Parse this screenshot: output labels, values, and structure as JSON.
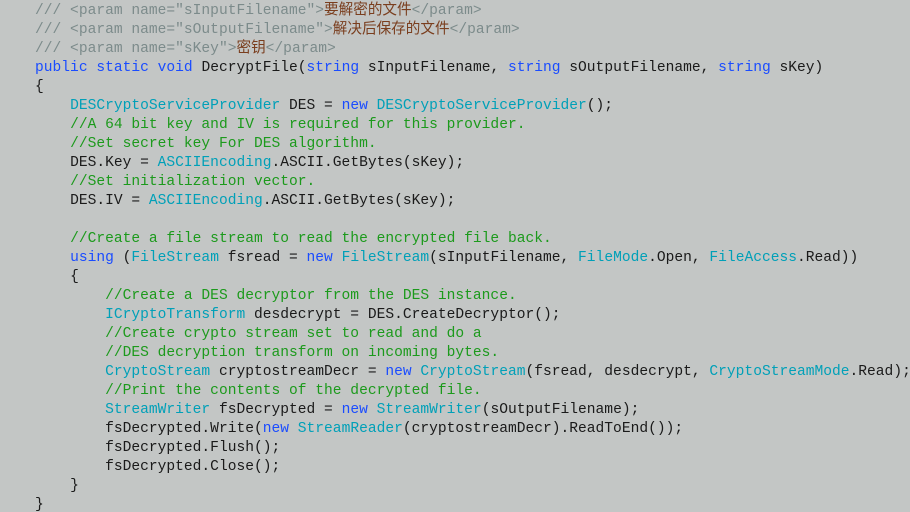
{
  "code": {
    "xml1_pre": "/// <param name=\"sInputFilename\">",
    "xml1_cjk": "要解密的文件",
    "xml1_post": "</param>",
    "xml2_pre": "/// <param name=\"sOutputFilename\">",
    "xml2_cjk": "解决后保存的文件",
    "xml2_post": "</param>",
    "xml3_pre": "/// <param name=\"sKey\">",
    "xml3_cjk": "密钥",
    "xml3_post": "</param>",
    "kw_public": "public",
    "kw_static": "static",
    "kw_void": "void",
    "kw_string": "string",
    "kw_new": "new",
    "kw_using": "using",
    "fn_name": " DecryptFile(",
    "p1": " sInputFilename, ",
    "p2": " sOutputFilename, ",
    "p3": " sKey)",
    "brace_o": "{",
    "brace_c": "}",
    "t_des": "DESCryptoServiceProvider",
    "l_des_decl": " DES = ",
    "l_des_decl2": "();",
    "c_64": "//A 64 bit key and IV is required for this provider.",
    "c_setkey": "//Set secret key For DES algorithm.",
    "l_key1": "DES.Key = ",
    "t_ascii": "ASCIIEncoding",
    "l_key2": ".ASCII.GetBytes(sKey);",
    "c_setiv": "//Set initialization vector.",
    "l_iv1": "DES.IV = ",
    "c_cfs": "//Create a file stream to read the encrypted file back.",
    "l_us1": " (",
    "t_fs": "FileStream",
    "l_us2": " fsread = ",
    "l_us3": "(sInputFilename, ",
    "t_fm": "FileMode",
    "l_us4": ".Open, ",
    "t_fa": "FileAccess",
    "l_us5": ".Read))",
    "c_cdd": "//Create a DES decryptor from the DES instance.",
    "t_ict": "ICryptoTransform",
    "l_ict": " desdecrypt = DES.CreateDecryptor();",
    "c_ccs1": "//Create crypto stream set to read and do a",
    "c_ccs2": "//DES decryption transform on incoming bytes.",
    "t_cs": "CryptoStream",
    "l_cs1": " cryptostreamDecr = ",
    "l_cs2": "(fsread, desdecrypt, ",
    "t_csm": "CryptoStreamMode",
    "l_cs3": ".Read);",
    "c_print": "//Print the contents of the decrypted file.",
    "t_sw": "StreamWriter",
    "l_sw1": " fsDecrypted = ",
    "l_sw2": "(sOutputFilename);",
    "l_wr1": "fsDecrypted.Write(",
    "t_sr": "StreamReader",
    "l_wr2": "(cryptostreamDecr).ReadToEnd());",
    "l_flush": "fsDecrypted.Flush();",
    "l_close": "fsDecrypted.Close();"
  }
}
